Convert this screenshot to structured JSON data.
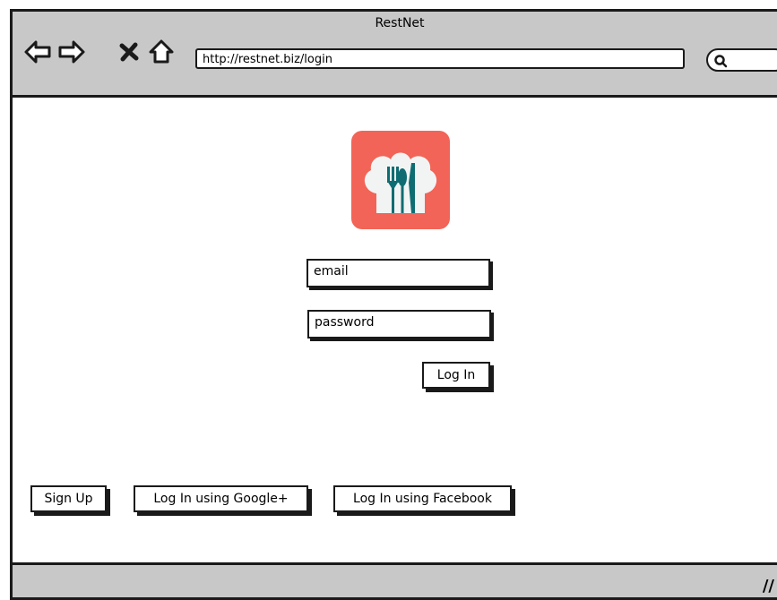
{
  "window": {
    "title": "RestNet"
  },
  "nav": {
    "back_icon": "arrow-left-icon",
    "forward_icon": "arrow-right-icon",
    "stop_icon": "close-icon",
    "home_icon": "home-icon"
  },
  "address_bar": {
    "url": "http://restnet.biz/login"
  },
  "search": {
    "icon": "search-icon"
  },
  "logo": {
    "icon": "chef-hat-cutlery-icon",
    "color": "#f26457",
    "accent": "#0f6d72"
  },
  "login_form": {
    "email_placeholder": "email",
    "password_placeholder": "password",
    "login_label": "Log In"
  },
  "social": {
    "signup_label": "Sign Up",
    "google_label": "Log In using Google+",
    "facebook_label": "Log In using Facebook"
  }
}
